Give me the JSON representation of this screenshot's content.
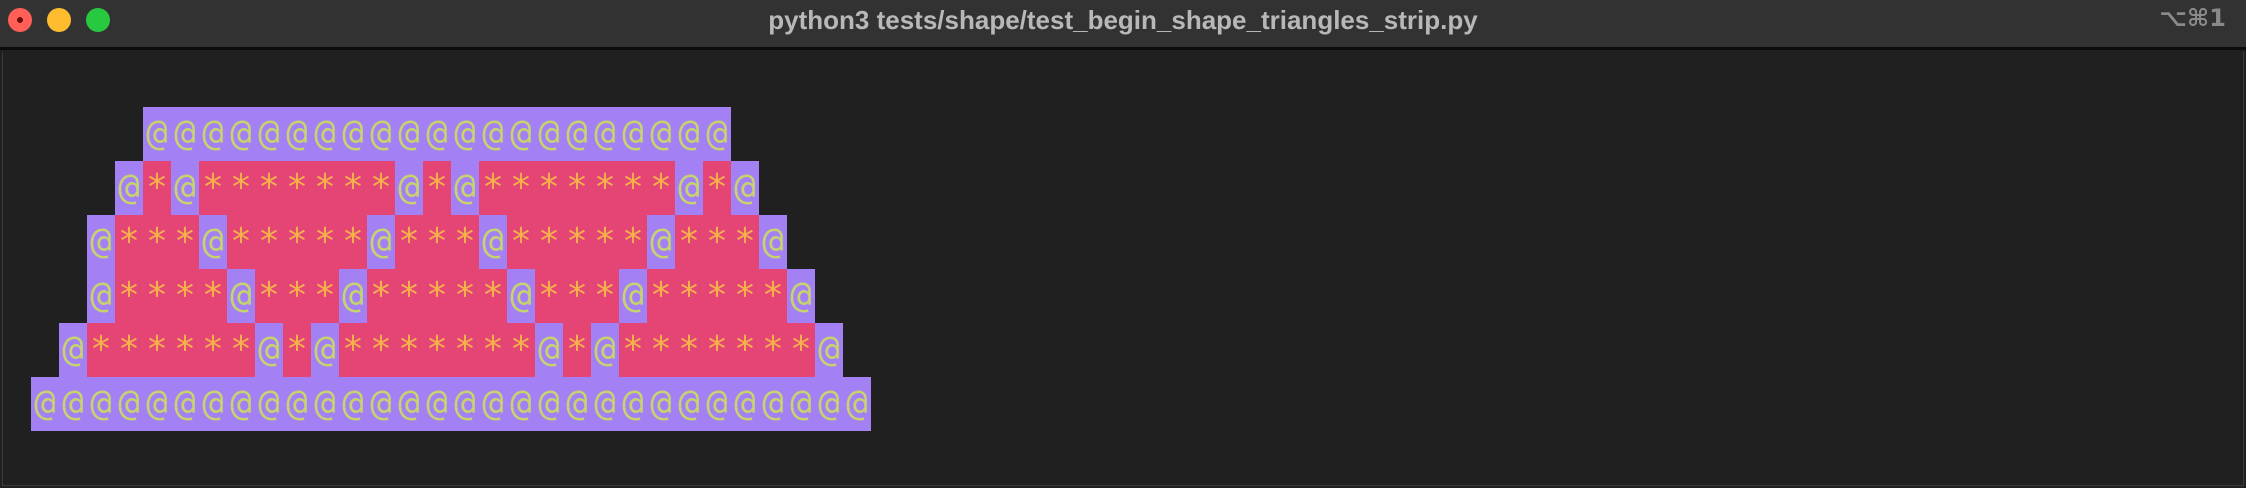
{
  "window": {
    "title": "python3 tests/shape/test_begin_shape_triangles_strip.py",
    "shortcut": "⌥⌘1",
    "traffic_lights": {
      "close_color": "#ff5f57",
      "minimize_color": "#febc2e",
      "zoom_color": "#28c840"
    }
  },
  "terminal": {
    "background": "#202020",
    "colors": {
      "at_background": "#a380f3",
      "at_foreground": "#c6d36f",
      "star_background": "#e44575",
      "star_foreground": "#f6b24a"
    },
    "lines": [
      "     @@@@@@@@@@@@@@@@@@@@@",
      "    @*@*******@*@*******@*@",
      "   @***@*****@***@*****@***@",
      "   @****@***@*****@***@*****@",
      "  @******@*@*******@*@*******@",
      " @@@@@@@@@@@@@@@@@@@@@@@@@@@@@@"
    ]
  }
}
